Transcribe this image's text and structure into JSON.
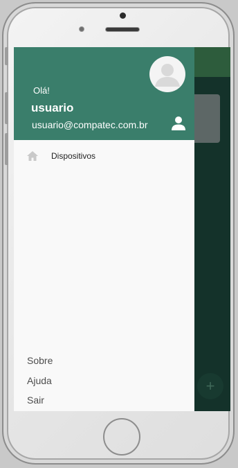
{
  "drawer": {
    "greeting": "Olá!",
    "user_name": "usuario",
    "user_email": "usuario@compatec.com.br",
    "menu": [
      {
        "label": "Dispositivos",
        "icon": "home-icon"
      }
    ],
    "footer_links": [
      "Sobre",
      "Ajuda",
      "Sair"
    ]
  },
  "app": {
    "fab_symbol": "+"
  },
  "colors": {
    "drawer_header": "#3a7e6b",
    "app_header": "#2d5c3c",
    "app_background": "#14322a"
  }
}
